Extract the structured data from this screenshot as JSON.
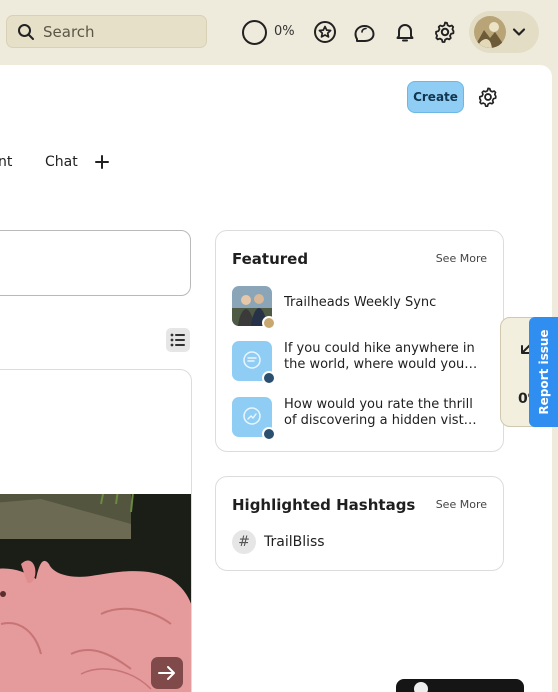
{
  "topbar": {
    "search_placeholder": "Search",
    "progress_label": "0%",
    "icons": [
      "search-icon",
      "progress-ring-icon",
      "star-badge-icon",
      "chat-bubbles-icon",
      "bell-icon",
      "gear-icon",
      "chevron-down-icon"
    ]
  },
  "toolbar": {
    "create_label": "Create"
  },
  "tabs": [
    {
      "label": "nt"
    },
    {
      "label": "Chat"
    }
  ],
  "featured": {
    "title": "Featured",
    "see_more": "See More",
    "items": [
      {
        "title": "Trailheads Weekly Sync"
      },
      {
        "line1": "If you could hike anywhere in",
        "line2": "the world, where would you…"
      },
      {
        "line1": "How would you rate the thrill",
        "line2": "of discovering a hidden vista …"
      }
    ]
  },
  "hashtags": {
    "title": "Highlighted Hashtags",
    "see_more": "See More",
    "items": [
      {
        "label": "TrailBliss"
      }
    ]
  },
  "side_widget": {
    "value": "0%"
  },
  "report_issue": {
    "label": "Report issue"
  },
  "colors": {
    "accent": "#8fcdf4",
    "report": "#2f8ef0",
    "background": "#efebdc"
  }
}
